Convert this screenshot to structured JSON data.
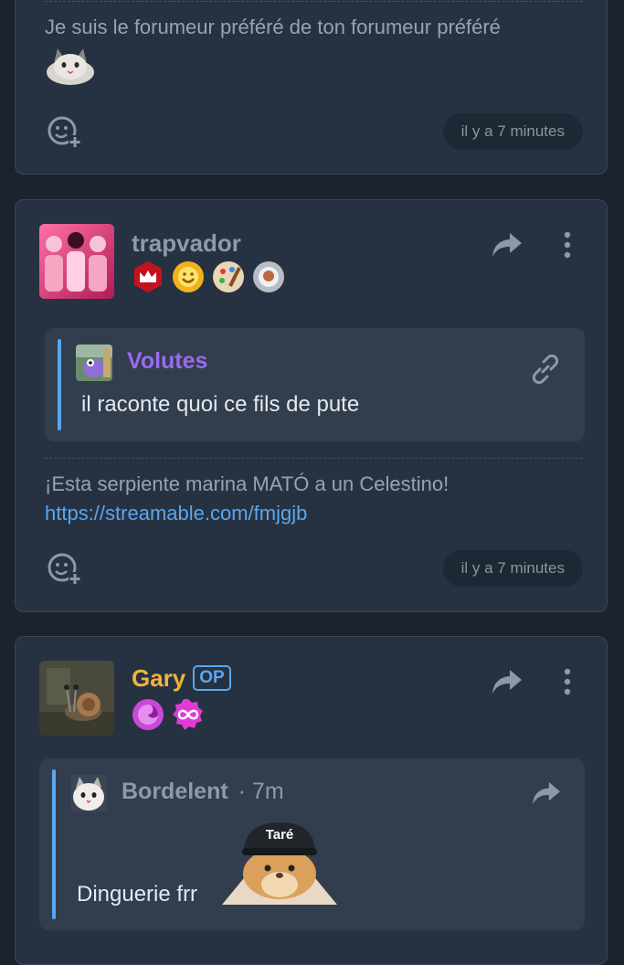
{
  "post1": {
    "text": "Je suis le forumeur préféré de ton forumeur préféré",
    "time": "il y a 7 minutes"
  },
  "post2": {
    "username": "trapvador",
    "quote": {
      "author": "Volutes",
      "text": "il raconte quoi ce fils de pute"
    },
    "text": "¡Esta serpiente marina MATÓ a un Celestino!",
    "link": "https://streamable.com/fmjgjb",
    "time": "il y a 7 minutes"
  },
  "post3": {
    "username": "Gary",
    "op_badge": "OP",
    "quote": {
      "author": "Bordelent",
      "meta": "· 7m",
      "text": "Dinguerie frr",
      "sticker_label": "Taré"
    }
  },
  "icons": [
    "add-reaction-icon",
    "share-icon",
    "more-vertical-icon",
    "link-icon"
  ],
  "colors": {
    "background": "#1b232e",
    "card": "#263241",
    "quote": "#323e4d",
    "username_default": "#8c9aab",
    "username_op": "#f2b33d",
    "volutes": "#9b6bf0",
    "link": "#5aa6ee"
  }
}
